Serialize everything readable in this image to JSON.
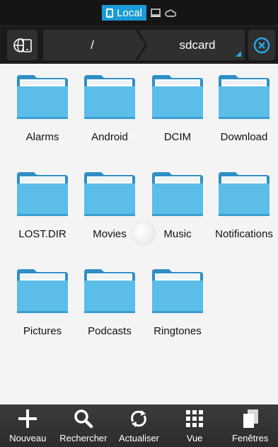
{
  "mode_bar": {
    "local_label": "Local",
    "icons": [
      "phone-icon",
      "computer-icon",
      "cloud-icon"
    ]
  },
  "path_bar": {
    "network_button_icon": "globe-device-icon",
    "breadcrumbs": [
      {
        "label": "/"
      },
      {
        "label": "sdcard"
      }
    ],
    "close_icon": "close-circle-icon"
  },
  "folders": [
    {
      "label": "Alarms"
    },
    {
      "label": "Android"
    },
    {
      "label": "DCIM"
    },
    {
      "label": "Download"
    },
    {
      "label": "LOST.DIR"
    },
    {
      "label": "Movies"
    },
    {
      "label": "Music"
    },
    {
      "label": "Notifications"
    },
    {
      "label": "Pictures"
    },
    {
      "label": "Podcasts"
    },
    {
      "label": "Ringtones"
    }
  ],
  "toolbar": {
    "new_label": "Nouveau",
    "search_label": "Rechercher",
    "refresh_label": "Actualiser",
    "view_label": "Vue",
    "windows_label": "Fenêtres"
  },
  "colors": {
    "accent": "#1a9bd6",
    "folder_blue": "#5bbde8",
    "folder_dark": "#2f8fc4",
    "content_bg": "#f4f4f4"
  }
}
